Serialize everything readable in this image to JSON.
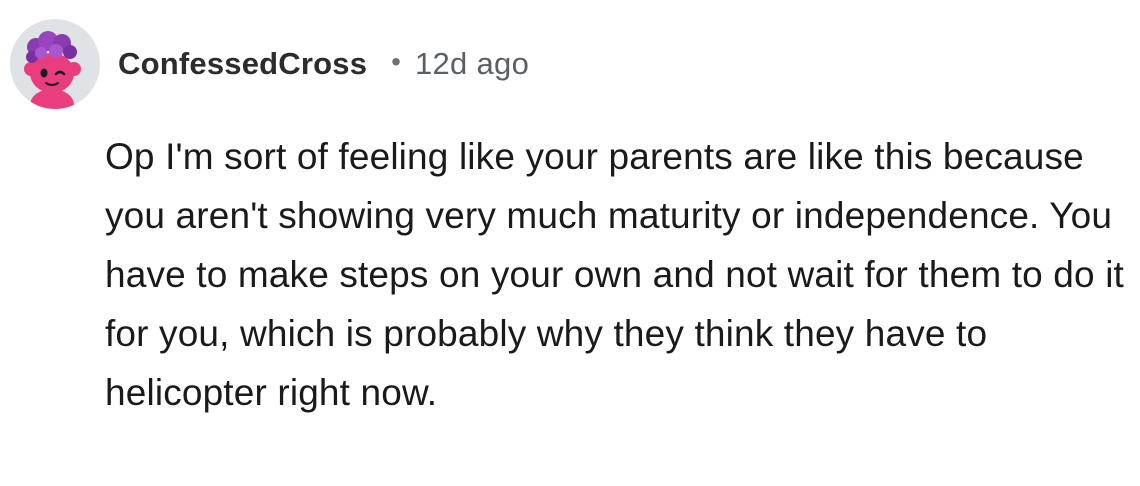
{
  "comment": {
    "author": "ConfessedCross",
    "separator": "•",
    "timestamp": "12d ago",
    "avatar_icon": "snoo-avatar-icon",
    "body": "Op I'm sort of feeling like your parents are like this because you aren't showing very much maturity or independence. You have to make steps on your own and not wait for them to do it for you, which is probably why they think they have to helicopter right now."
  },
  "colors": {
    "avatar_background": "#dfe3e6",
    "avatar_body": "#ea3d7d",
    "avatar_hair": "#8a3bb0",
    "username": "#2a2c2e",
    "timestamp": "#5a6066",
    "text": "#1a1a1b"
  }
}
